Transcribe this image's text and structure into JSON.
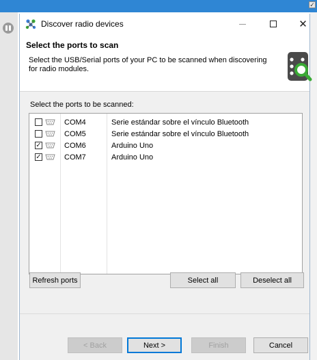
{
  "window": {
    "title": "Discover radio devices",
    "controls": {
      "minimize": "—",
      "maximize": "☐",
      "close": "✕"
    }
  },
  "header": {
    "title": "Select the ports to scan",
    "description": "Select the USB/Serial ports of your PC to be scanned when discovering for radio modules.",
    "icon": "radio-module-search-icon"
  },
  "ports": {
    "label": "Select the ports to be scanned:",
    "items": [
      {
        "name": "COM4",
        "description": "Serie estándar sobre el vínculo Bluetooth",
        "checked": false,
        "icon": "serial-port-icon"
      },
      {
        "name": "COM5",
        "description": "Serie estándar sobre el vínculo Bluetooth",
        "checked": false,
        "icon": "serial-port-icon"
      },
      {
        "name": "COM6",
        "description": "Arduino Uno",
        "checked": true,
        "icon": "serial-port-icon"
      },
      {
        "name": "COM7",
        "description": "Arduino Uno",
        "checked": true,
        "icon": "serial-port-icon"
      }
    ]
  },
  "actions": {
    "refresh": "Refresh ports",
    "select_all": "Select all",
    "deselect_all": "Deselect all"
  },
  "wizard": {
    "back": "< Back",
    "next": "Next >",
    "finish": "Finish",
    "cancel": "Cancel"
  },
  "colors": {
    "desktop_accent": "#2f86d4",
    "primary_border": "#0078d7",
    "icon_green": "#3aaa35"
  }
}
